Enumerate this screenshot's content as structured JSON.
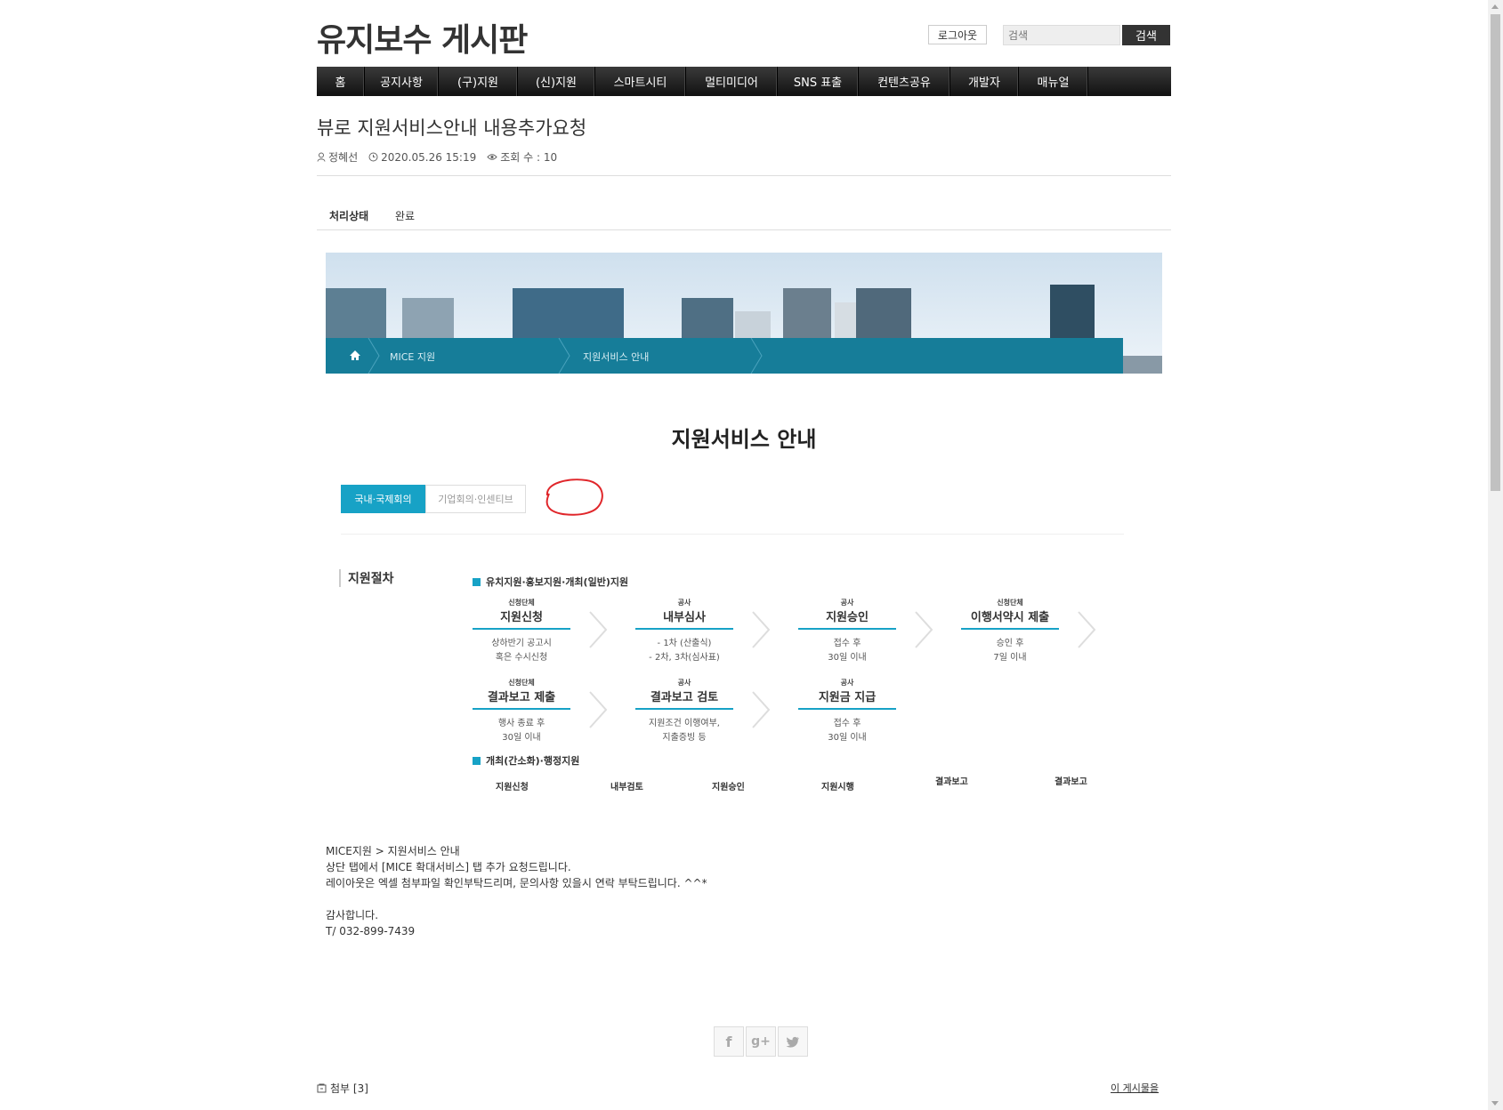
{
  "header": {
    "site_title": "유지보수 게시판",
    "logout_label": "로그아웃",
    "search_placeholder": "검색",
    "search_button": "검색"
  },
  "nav": {
    "items": [
      "홈",
      "공지사항",
      "(구)지원",
      "(신)지원",
      "스마트시티",
      "멀티미디어",
      "SNS 표출",
      "컨텐츠공유",
      "개발자",
      "매뉴얼"
    ]
  },
  "post": {
    "title": "뷰로 지원서비스안내 내용추가요청",
    "author": "정혜선",
    "datetime": "2020.05.26 15:19",
    "views": "조회 수 : 10",
    "status_label": "처리상태",
    "status_value": "완료"
  },
  "embedded": {
    "crumbs": [
      "MICE 지원",
      "지원서비스 안내"
    ],
    "heading": "지원서비스 안내",
    "tabs": [
      "국내·국제회의",
      "기업회의·인센티브"
    ],
    "procedure_label": "지원절차",
    "group1_title": "유치지원·홍보지원·개최(일반)지원",
    "steps": [
      {
        "who": "신청단체",
        "name": "지원신청",
        "desc": "상하반기 공고시\n혹은 수시신청"
      },
      {
        "who": "공사",
        "name": "내부심사",
        "desc": "- 1차 (산출식)\n- 2차, 3차(심사표)"
      },
      {
        "who": "공사",
        "name": "지원승인",
        "desc": "접수 후\n30일 이내"
      },
      {
        "who": "신청단체",
        "name": "이행서약시 제출",
        "desc": "승인 후\n7일 이내"
      },
      {
        "who": "신청단체",
        "name": "결과보고 제출",
        "desc": "행사 종료 후\n30일 이내"
      },
      {
        "who": "공사",
        "name": "결과보고 검토",
        "desc": "지원조건 이행여부,\n지출증빙 등"
      },
      {
        "who": "공사",
        "name": "지원금 지급",
        "desc": "접수 후\n30일 이내"
      }
    ],
    "group2_title": "개최(간소화)·행정지원",
    "group2_steps": [
      "지원신청",
      "내부검토",
      "지원승인",
      "지원시행",
      "결과보고",
      "결과보고"
    ]
  },
  "body_lines": [
    "MICE지원 > 지원서비스 안내",
    "상단 탭에서 [MICE 확대서비스] 탭 추가 요청드립니다.",
    "레이아웃은 엑셀 첨부파일 확인부탁드리며, 문의사항 있을시 연락 부탁드립니다. ^^*",
    "",
    "감사합니다.",
    "T/ 032-899-7439"
  ],
  "footer": {
    "attach_label": "첨부 [3]",
    "to_post_label": "이 게시물을"
  },
  "icons": {
    "share": [
      "facebook-icon",
      "google-plus-icon",
      "twitter-icon"
    ]
  },
  "colors": {
    "accent": "#17a2c6",
    "crumb_bar": "#167d99",
    "nav_bg": "#1a1a1a"
  }
}
